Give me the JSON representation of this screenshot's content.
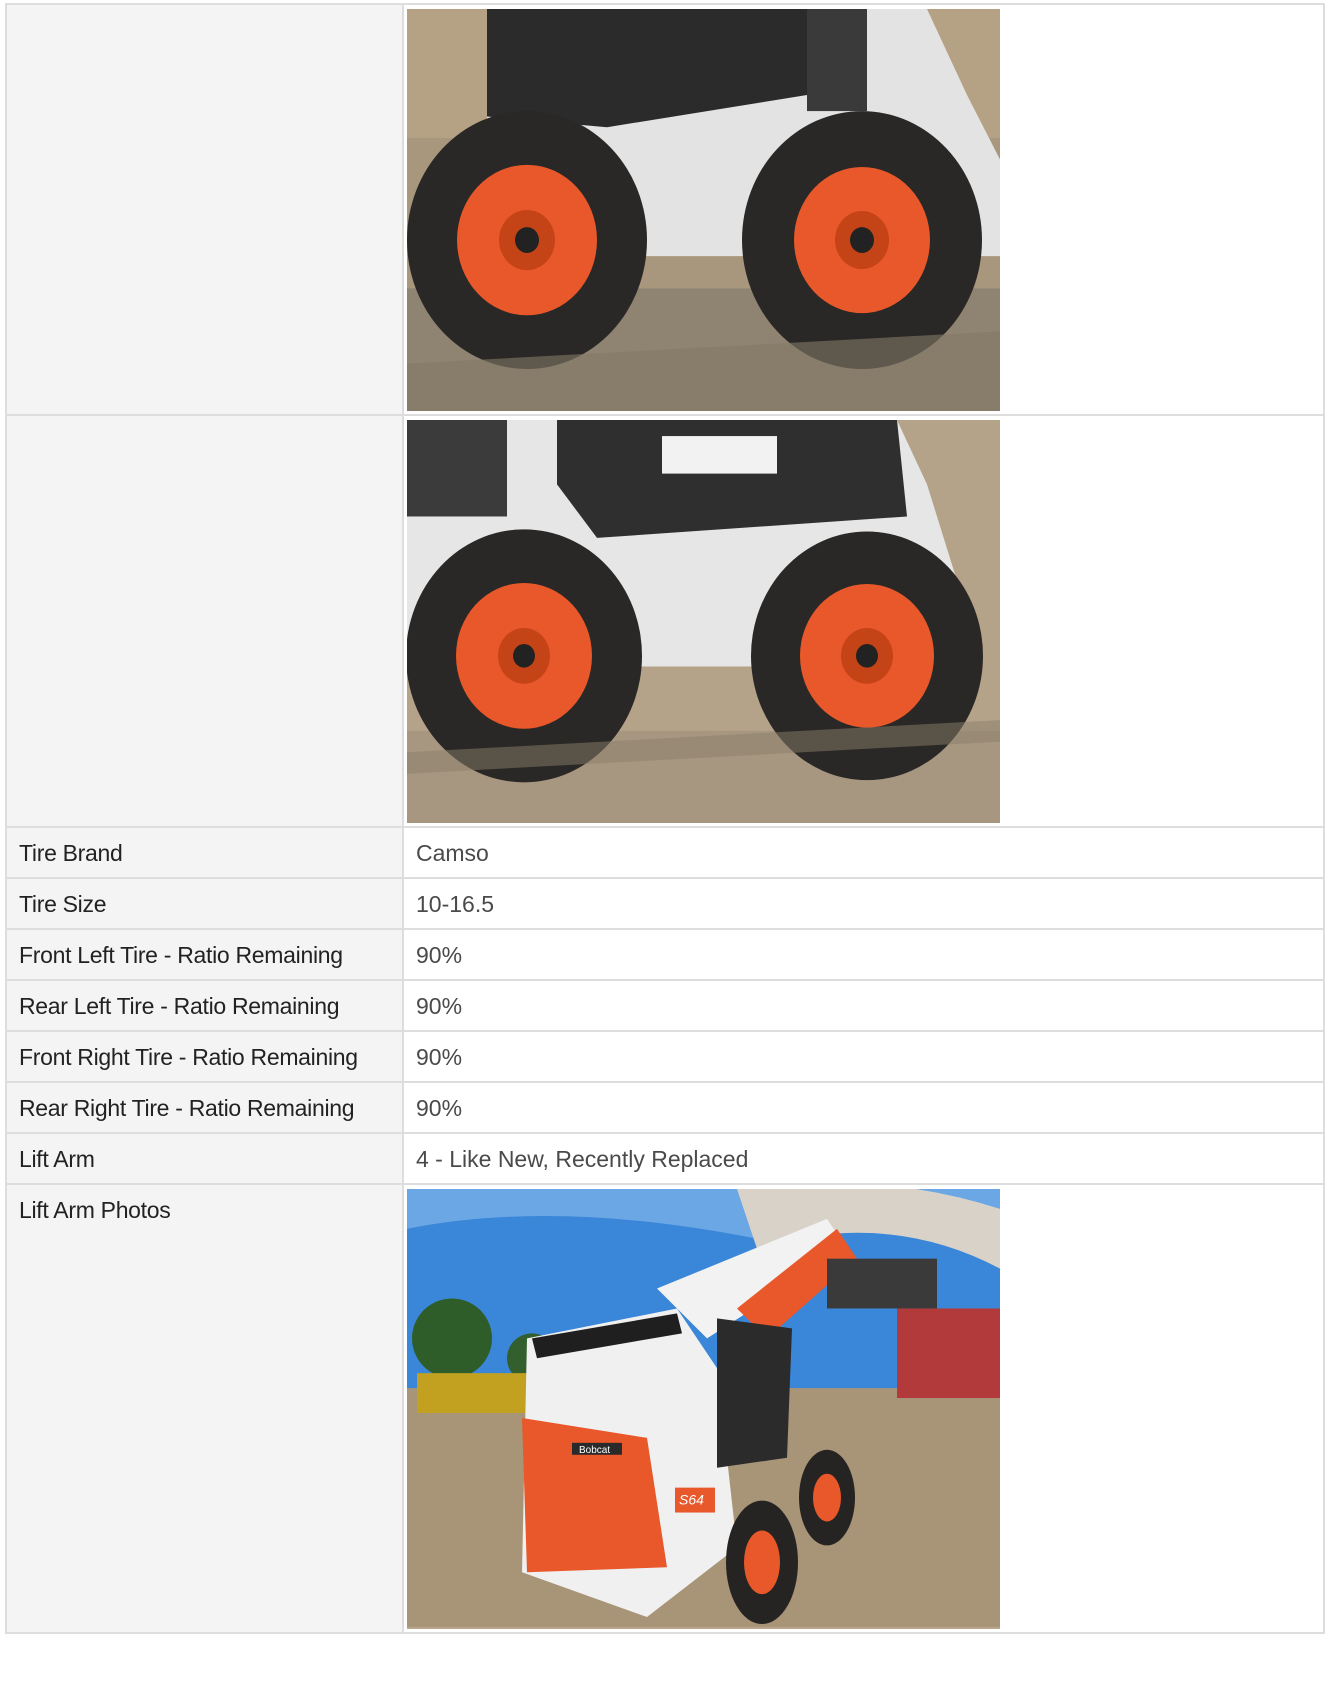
{
  "rows": [
    {
      "label": "",
      "type": "photo",
      "photo": "skid-steer-left-side-tires-photo"
    },
    {
      "label": "",
      "type": "photo",
      "photo": "skid-steer-right-side-tires-photo"
    },
    {
      "label": "Tire Brand",
      "value": "Camso"
    },
    {
      "label": "Tire Size",
      "value": "10-16.5"
    },
    {
      "label": "Front Left Tire - Ratio Remaining",
      "value": "90%"
    },
    {
      "label": "Rear Left Tire - Ratio Remaining",
      "value": "90%"
    },
    {
      "label": "Front Right Tire - Ratio Remaining",
      "value": "90%"
    },
    {
      "label": "Rear Right Tire - Ratio Remaining",
      "value": "90%"
    },
    {
      "label": "Lift Arm",
      "value": "4 - Like New, Recently Replaced"
    },
    {
      "label": "Lift Arm Photos",
      "type": "photo",
      "photo": "bobcat-lift-arm-photo"
    }
  ],
  "photo_labels": {
    "bobcat_logo": "Bobcat",
    "model": "S64"
  },
  "colors": {
    "wheel_orange": "#e8582a",
    "machine_white": "#e6e6e6",
    "sky_blue": "#3a86d8",
    "dirt": "#b9a58c"
  }
}
